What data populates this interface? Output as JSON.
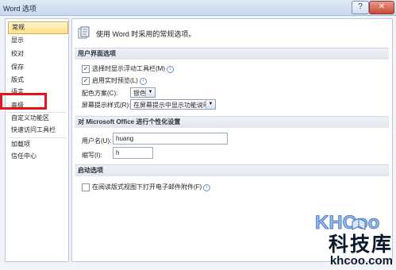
{
  "window": {
    "title": "Word 选项",
    "help_label": "?",
    "close_label": "✕"
  },
  "sidebar": {
    "items": [
      {
        "label": "常规"
      },
      {
        "label": "显示"
      },
      {
        "label": "校对"
      },
      {
        "label": "保存"
      },
      {
        "label": "版式"
      },
      {
        "label": "语言"
      },
      {
        "label": "高级"
      },
      {
        "label": "自定义功能区"
      },
      {
        "label": "快速访问工具栏"
      },
      {
        "label": "加载项"
      },
      {
        "label": "信任中心"
      }
    ],
    "selected": "常规",
    "highlighted": "高级",
    "highlight_color": "#e4161b"
  },
  "main": {
    "header": "使用 Word 时采用的常规选项。",
    "ui_section": {
      "title": "用户界面选项",
      "show_mini_toolbar": {
        "label": "选择时显示浮动工具栏(M)",
        "checked": true
      },
      "live_preview": {
        "label": "启用实时预览(L)",
        "checked": true
      },
      "color_scheme": {
        "label": "配色方案(C):",
        "value": "银色"
      },
      "screentip_style": {
        "label": "屏幕提示样式(R):",
        "value": "在屏幕提示中显示功能说明"
      }
    },
    "personalize_section": {
      "title": "对 Microsoft Office 进行个性化设置",
      "username": {
        "label": "用户名(U):",
        "value": "huang"
      },
      "initials": {
        "label": "缩写(I):",
        "value": "h"
      }
    },
    "startup_section": {
      "title": "启动选项",
      "open_attachments_reading": {
        "label": "在阅读版式视图下打开电子邮件附件(F)",
        "checked": false
      }
    }
  },
  "watermark": {
    "logo_text": "KHCoo",
    "site_name": "科技库",
    "url": "khcoo.com"
  },
  "colors": {
    "accent_selected": "#ffe08a",
    "section_bg": "#e6ebf2"
  }
}
